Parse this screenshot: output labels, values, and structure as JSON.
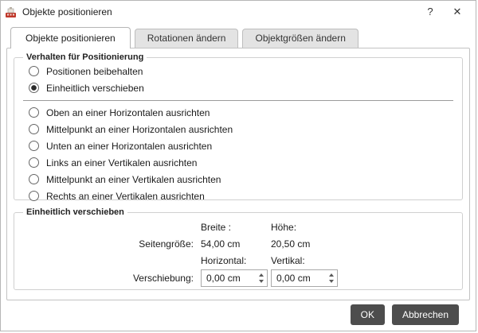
{
  "window": {
    "title": "Objekte positionieren",
    "help_label": "?",
    "close_label": "✕"
  },
  "tabs": [
    {
      "label": "Objekte positionieren",
      "active": true
    },
    {
      "label": "Rotationen ändern",
      "active": false
    },
    {
      "label": "Objektgrößen ändern",
      "active": false
    }
  ],
  "positioning_group": {
    "title": "Verhalten für Positionierung",
    "options": [
      {
        "label": "Positionen beibehalten",
        "selected": false
      },
      {
        "label": "Einheitlich verschieben",
        "selected": true
      },
      {
        "label": "Oben an einer Horizontalen ausrichten",
        "selected": false
      },
      {
        "label": "Mittelpunkt an einer Horizontalen ausrichten",
        "selected": false
      },
      {
        "label": "Unten an einer Horizontalen ausrichten",
        "selected": false
      },
      {
        "label": "Links an einer Vertikalen ausrichten",
        "selected": false
      },
      {
        "label": "Mittelpunkt an einer Vertikalen ausrichten",
        "selected": false
      },
      {
        "label": "Rechts an einer Vertikalen ausrichten",
        "selected": false
      }
    ]
  },
  "shift_group": {
    "title": "Einheitlich verschieben",
    "width_header": "Breite :",
    "height_header": "Höhe:",
    "page_size_label": "Seitengröße:",
    "page_width_value": "54,00 cm",
    "page_height_value": "20,50 cm",
    "horizontal_header": "Horizontal:",
    "vertical_header": "Vertikal:",
    "shift_label": "Verschiebung:",
    "horizontal_shift_value": "0,00 cm",
    "vertical_shift_value": "0,00 cm"
  },
  "footer": {
    "ok_label": "OK",
    "cancel_label": "Abbrechen"
  },
  "colors": {
    "button_bg": "#4d4d4d",
    "inactive_tab_bg": "#e3e3e3",
    "app_icon_red": "#c0392b"
  }
}
